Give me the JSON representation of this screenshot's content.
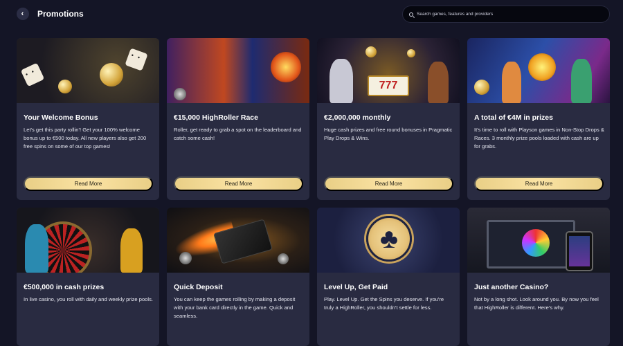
{
  "header": {
    "back_icon": "chevron-left-icon",
    "title": "Promotions",
    "search": {
      "icon": "search-icon",
      "placeholder": "Search games, features and providers"
    }
  },
  "promotions": [
    {
      "title": "Your Welcome Bonus",
      "description": "Let's get this party rollin'! Get your 100% welcome bonus up to €500 today. All new players also get 200 free spins on some of our top games!",
      "button": "Read More"
    },
    {
      "title": "€15,000 HighRoller Race",
      "description": "Roller, get ready to grab a spot on the leaderboard and catch some cash!",
      "button": "Read More"
    },
    {
      "title": "€2,000,000 monthly",
      "description": "Huge cash prizes and free round bonuses in Pragmatic Play Drops & Wins.",
      "button": "Read More"
    },
    {
      "title": "A total of €4M in prizes",
      "description": "It's time to roll with Playson games in Non-Stop Drops & Races. 3 monthly prize pools loaded with cash are up for grabs.",
      "button": "Read More"
    },
    {
      "title": "€500,000 in cash prizes",
      "description": "In live casino, you roll with daily and weekly prize pools."
    },
    {
      "title": "Quick Deposit",
      "description": "You can keep the games rolling by making a deposit with your bank card directly in the game. Quick and seamless."
    },
    {
      "title": "Level Up, Get Paid",
      "description": "Play. Level Up. Get the Spins you deserve. If you're truly a HighRoller, you shouldn't settle for less."
    },
    {
      "title": "Just another Casino?",
      "description": "Not by a long shot. Look around you. By now you feel that HighRoller is different. Here's why."
    }
  ],
  "colors": {
    "background": "#141526",
    "card": "#292b41",
    "button": "#f7dd9c"
  }
}
